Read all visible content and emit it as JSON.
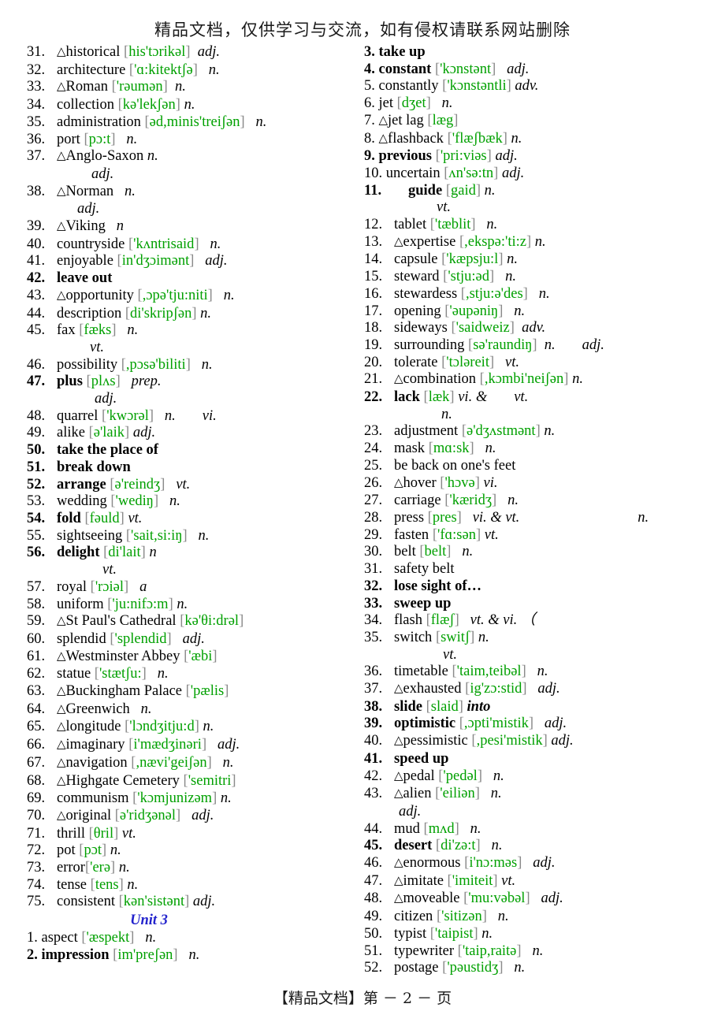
{
  "header": {
    "watermark_top": "精品文档，仅供学习与交流，如有侵权请联系网站删除"
  },
  "footer": {
    "watermark_bottom": "【精品文档】第 － 2 － 页"
  },
  "colors": {
    "phonetic_green": "#00a000",
    "bracket_gray": "#8a8a8a",
    "unit_blue": "#2222cc"
  },
  "unit_heading": "Unit 3",
  "left_column": [
    {
      "num": "31.",
      "tri": true,
      "word": "historical",
      "ph": "his'tɔrikəl",
      "pos": "adj.",
      "bold": false,
      "gap": "  "
    },
    {
      "num": "32.",
      "tri": false,
      "word": "architecture",
      "ph": "'ɑ:kitektʃə",
      "pos": "n.",
      "bold": false,
      "gap": "   "
    },
    {
      "num": "33.",
      "tri": true,
      "word": "Roman",
      "ph": "'rəumən",
      "pos": "n.",
      "bold": false,
      "gap": "  "
    },
    {
      "num": "34.",
      "tri": false,
      "word": "collection",
      "ph": "kə'lekʃən",
      "pos": "n.",
      "bold": false,
      "gap": " "
    },
    {
      "num": "35.",
      "tri": false,
      "word": "administration",
      "ph": "əd,minis'treiʃən",
      "pos": "n.",
      "bold": false,
      "gap": "   "
    },
    {
      "num": "36.",
      "tri": false,
      "word": "port",
      "ph": "pɔ:t",
      "pos": "n.",
      "bold": false,
      "gap": "   "
    },
    {
      "num": "37.",
      "tri": true,
      "word": "Anglo-Saxon",
      "ph": "",
      "pos": "n.",
      "bold": false,
      "gap": " "
    },
    {
      "cont": "adj.",
      "indent": 82
    },
    {
      "num": "38.",
      "tri": true,
      "word": "Norman",
      "ph": "",
      "pos": "n.",
      "bold": false,
      "gap": "   "
    },
    {
      "cont": "adj.",
      "indent": 64
    },
    {
      "num": "39.",
      "tri": true,
      "word": "Viking",
      "ph": "",
      "pos": "n",
      "bold": false,
      "gap": "   "
    },
    {
      "num": "40.",
      "tri": false,
      "word": "countryside",
      "ph": "'kʌntrisaid",
      "pos": "n.",
      "bold": false,
      "gap": "   "
    },
    {
      "num": "41.",
      "tri": false,
      "word": "enjoyable",
      "ph": "in'dʒɔimənt",
      "pos": "adj.",
      "bold": false,
      "gap": "   "
    },
    {
      "num": "42.",
      "tri": false,
      "word": "leave out",
      "ph": "",
      "pos": "",
      "bold": true,
      "gap": ""
    },
    {
      "num": "43.",
      "tri": true,
      "word": "opportunity",
      "ph": ",ɔpə'tju:niti",
      "pos": "n.",
      "bold": false,
      "gap": "   "
    },
    {
      "num": "44.",
      "tri": false,
      "word": "description",
      "ph": "di'skripʃən",
      "pos": "n.",
      "bold": false,
      "gap": " "
    },
    {
      "num": "45.",
      "tri": false,
      "word": "fax",
      "ph": "fæks",
      "pos": "n.",
      "bold": false,
      "gap": "   "
    },
    {
      "cont": "vt.",
      "indent": 80
    },
    {
      "num": "46.",
      "tri": false,
      "word": "possibility",
      "ph": ",pɔsə'biliti",
      "pos": "n.",
      "bold": false,
      "gap": "   "
    },
    {
      "num": "47.",
      "tri": false,
      "word": "plus",
      "ph": "plʌs",
      "pos": "prep.",
      "bold": true,
      "gap": "   "
    },
    {
      "cont": "adj.",
      "indent": 86
    },
    {
      "num": "48.",
      "tri": false,
      "word": "quarrel",
      "ph": "'kwɔrəl",
      "pos": "n.",
      "pos2": "vi.",
      "bold": false,
      "gap": "   "
    },
    {
      "num": "49.",
      "tri": false,
      "word": "alike",
      "ph": "ə'laik",
      "pos": "adj.",
      "bold": false,
      "gap": " "
    },
    {
      "num": "50.",
      "tri": false,
      "word": "take the place of",
      "ph": "",
      "pos": "",
      "bold": true,
      "gap": ""
    },
    {
      "num": "51.",
      "tri": false,
      "word": "break down",
      "ph": "",
      "pos": "",
      "bold": true,
      "gap": ""
    },
    {
      "num": "52.",
      "tri": false,
      "word": "arrange",
      "ph": "ə'reindʒ",
      "pos": "vt.",
      "bold": true,
      "gap": "   "
    },
    {
      "num": "53.",
      "tri": false,
      "word": "wedding",
      "ph": "'wediŋ",
      "pos": "n.",
      "bold": false,
      "gap": "   "
    },
    {
      "num": "54.",
      "tri": false,
      "word": "fold",
      "ph": "fəuld",
      "pos": "vt.",
      "bold": true,
      "gap": " "
    },
    {
      "num": "55.",
      "tri": false,
      "word": "sightseeing",
      "ph": "'sait,si:iŋ",
      "pos": "n.",
      "bold": false,
      "gap": "   "
    },
    {
      "num": "56.",
      "tri": false,
      "word": "delight",
      "ph": "di'lait",
      "pos": "n",
      "bold": true,
      "gap": " "
    },
    {
      "cont": "vt.",
      "indent": 96
    },
    {
      "num": "57.",
      "tri": false,
      "word": "royal",
      "ph": "'rɔiəl",
      "pos": "a",
      "bold": false,
      "gap": "   "
    },
    {
      "num": "58.",
      "tri": false,
      "word": "uniform",
      "ph": "'ju:nifɔ:m",
      "pos": "n.",
      "bold": false,
      "gap": " "
    },
    {
      "num": "59.",
      "tri": true,
      "word": "St Paul's Cathedral",
      "ph": "kə'θi:drəl",
      "pos": "",
      "bold": false,
      "gap": "  "
    },
    {
      "num": "60.",
      "tri": false,
      "word": "splendid",
      "ph": "'splendid",
      "pos": "adj.",
      "bold": false,
      "gap": "   "
    },
    {
      "num": "61.",
      "tri": true,
      "word": "Westminster Abbey",
      "ph": "'æbi",
      "pos": "",
      "bold": false,
      "gap": " "
    },
    {
      "num": "62.",
      "tri": false,
      "word": "statue",
      "ph": "'stætʃu:",
      "pos": "n.",
      "bold": false,
      "gap": "   "
    },
    {
      "num": "63.",
      "tri": true,
      "word": "Buckingham   Palace",
      "ph": "'pælis",
      "pos": "",
      "bold": false,
      "gap": " "
    },
    {
      "num": "64.",
      "tri": true,
      "word": "Greenwich",
      "ph": "",
      "pos": "n.",
      "bold": false,
      "gap": "   "
    },
    {
      "num": "65.",
      "tri": true,
      "word": "longitude",
      "ph": "'lɔndʒitju:d",
      "pos": "n.",
      "bold": false,
      "gap": ""
    },
    {
      "num": "66.",
      "tri": true,
      "word": "imaginary",
      "ph": "i'mædʒinəri",
      "pos": "adj.",
      "bold": false,
      "gap": "   "
    },
    {
      "num": "67.",
      "tri": true,
      "word": "navigation",
      "ph": ",nævi'geiʃən",
      "pos": "n.",
      "bold": false,
      "gap": "   "
    },
    {
      "num": "68.",
      "tri": true,
      "word": "Highgate Cemetery",
      "ph": "'semitri",
      "pos": "",
      "bold": false,
      "gap": " "
    },
    {
      "num": "69.",
      "tri": false,
      "word": "communism",
      "ph": "'kɔmjunizəm",
      "pos": "n.",
      "bold": false,
      "gap": " "
    },
    {
      "num": "70.",
      "tri": true,
      "word": "original",
      "ph": "ə'ridʒənəl",
      "pos": "adj.",
      "bold": false,
      "gap": "   "
    },
    {
      "num": "71.",
      "tri": false,
      "word": "thrill",
      "ph": "θril",
      "pos": "vt.",
      "bold": false,
      "gap": " "
    },
    {
      "num": "72.",
      "tri": false,
      "word": "pot",
      "ph": "pɔt",
      "pos": "n.",
      "bold": false,
      "gap": " "
    },
    {
      "num": "73.",
      "tri": false,
      "word": "error",
      "ph": "'erə",
      "pos": "n.",
      "bold": false,
      "gap": "",
      "nospace": true
    },
    {
      "num": "74.",
      "tri": false,
      "word": "tense",
      "ph": "tens",
      "pos": "n.",
      "bold": false,
      "gap": " "
    },
    {
      "num": "75.",
      "tri": false,
      "word": "consistent",
      "ph": "kən'sistənt",
      "pos": "adj.",
      "bold": false,
      "gap": " "
    },
    {
      "unit": true
    },
    {
      "num": "1.",
      "tri": false,
      "word": "aspect",
      "ph": "'æspekt",
      "pos": "n.",
      "bold": false,
      "gap": "   ",
      "tight": true
    },
    {
      "num": "2.",
      "tri": false,
      "word": "impression",
      "ph": "im'preʃən",
      "pos": "n.",
      "bold": true,
      "gap": "   ",
      "tight": true
    }
  ],
  "right_column": [
    {
      "num": "3.",
      "tri": false,
      "word": "take up",
      "ph": "",
      "pos": "",
      "bold": true,
      "gap": "",
      "tight": true
    },
    {
      "num": "4.",
      "tri": false,
      "word": "constant",
      "ph": "'kɔnstənt",
      "pos": "adj.",
      "bold": true,
      "gap": "   ",
      "tight": true
    },
    {
      "num": "5.",
      "tri": false,
      "word": "constantly",
      "ph": "'kɔnstəntli",
      "pos": "adv.",
      "bold": false,
      "gap": " ",
      "tight": true
    },
    {
      "num": "6.",
      "tri": false,
      "word": "jet",
      "ph": "dʒet",
      "pos": "n.",
      "bold": false,
      "gap": "   ",
      "tight": true
    },
    {
      "num": "7.",
      "tri": true,
      "word": "jet lag",
      "ph": "læg",
      "pos": "",
      "bold": false,
      "gap": " ",
      "tight": true
    },
    {
      "num": "8.",
      "tri": true,
      "word": "flashback",
      "ph": "'flæʃbæk",
      "pos": "n.",
      "bold": false,
      "gap": " ",
      "tight": true
    },
    {
      "num": "9.",
      "tri": false,
      "word": "previous",
      "ph": "'pri:viəs",
      "pos": "adj.",
      "bold": true,
      "gap": " ",
      "tight": true
    },
    {
      "num": "10.",
      "tri": false,
      "word": "uncertain",
      "ph": "ʌn'sə:tn",
      "pos": "adj.",
      "bold": false,
      "gap": " ",
      "tight": true
    },
    {
      "num": "11.",
      "tri": false,
      "word": "guide",
      "ph": "gaid",
      "pos": "n.",
      "bold": true,
      "gap": " ",
      "extraindent": true
    },
    {
      "cont": "vt.",
      "indent": 92
    },
    {
      "num": "12.",
      "tri": false,
      "word": "tablet",
      "ph": "'tæblit",
      "pos": "n.",
      "bold": false,
      "gap": "   "
    },
    {
      "num": "13.",
      "tri": true,
      "word": "expertise",
      "ph": ",ekspə:'ti:z",
      "pos": "n.",
      "bold": false,
      "gap": " "
    },
    {
      "num": "14.",
      "tri": false,
      "word": "capsule",
      "ph": "'kæpsju:l",
      "pos": "n.",
      "bold": false,
      "gap": " "
    },
    {
      "num": "15.",
      "tri": false,
      "word": "steward",
      "ph": "'stju:əd",
      "pos": "n.",
      "bold": false,
      "gap": "   "
    },
    {
      "num": "16.",
      "tri": false,
      "word": "stewardess",
      "ph": ",stju:ə'des",
      "pos": "n.",
      "bold": false,
      "gap": "   "
    },
    {
      "num": "17.",
      "tri": false,
      "word": "opening",
      "ph": "'əupəniŋ",
      "pos": "n.",
      "bold": false,
      "gap": "   "
    },
    {
      "num": "18.",
      "tri": false,
      "word": "sideways",
      "ph": "'saidweiz",
      "pos": "adv.",
      "bold": false,
      "gap": "  "
    },
    {
      "num": "19.",
      "tri": false,
      "word": "surrounding",
      "ph": "sə'raundiŋ",
      "pos": "n.",
      "pos2": "adj.",
      "bold": false,
      "gap": "  "
    },
    {
      "num": "20.",
      "tri": false,
      "word": "tolerate",
      "ph": "'tɔləreit",
      "pos": "vt.",
      "bold": false,
      "gap": "   "
    },
    {
      "num": "21.",
      "tri": true,
      "word": "combination",
      "ph": ",kɔmbi'neiʃən",
      "pos": "n.",
      "bold": false,
      "gap": " "
    },
    {
      "num": "22.",
      "tri": false,
      "word": "lack",
      "ph": "læk",
      "pos": "vi. &",
      "pos2": "vt.",
      "bold": true,
      "gap": " "
    },
    {
      "cont": "n.",
      "indent": 98
    },
    {
      "num": "23.",
      "tri": false,
      "word": "adjustment",
      "ph": "ə'dʒʌstmənt",
      "pos": "n.",
      "bold": false,
      "gap": " "
    },
    {
      "num": "24.",
      "tri": false,
      "word": "mask",
      "ph": "mɑ:sk",
      "pos": "n.",
      "bold": false,
      "gap": "   "
    },
    {
      "num": "25.",
      "tri": false,
      "word": "be back on one's feet",
      "ph": "",
      "pos": "",
      "bold": false,
      "gap": ""
    },
    {
      "num": "26.",
      "tri": true,
      "word": "hover",
      "ph": "'hɔvə",
      "pos": "vi.",
      "bold": false,
      "gap": " "
    },
    {
      "num": "27.",
      "tri": false,
      "word": "carriage",
      "ph": "'kæridʒ",
      "pos": "n.",
      "bold": false,
      "gap": "   "
    },
    {
      "num": "28.",
      "tri": false,
      "word": "press",
      "ph": "pres",
      "pos": "vi. & vt.",
      "pos3": "n.",
      "bold": false,
      "gap": "   "
    },
    {
      "num": "29.",
      "tri": false,
      "word": "fasten",
      "ph": "'fɑ:sən",
      "pos": "vt.",
      "bold": false,
      "gap": " "
    },
    {
      "num": "30.",
      "tri": false,
      "word": "belt",
      "ph": "belt",
      "pos": "n.",
      "bold": false,
      "gap": "   "
    },
    {
      "num": "31.",
      "tri": false,
      "word": "safety belt",
      "ph": "",
      "pos": "",
      "bold": false,
      "gap": ""
    },
    {
      "num": "32.",
      "tri": false,
      "word": "lose sight of…",
      "ph": "",
      "pos": "",
      "bold": true,
      "gap": ""
    },
    {
      "num": "33.",
      "tri": false,
      "word": "sweep up",
      "ph": "",
      "pos": "",
      "bold": true,
      "gap": ""
    },
    {
      "num": "34.",
      "tri": false,
      "word": "flash",
      "ph": "flæʃ",
      "pos": "vt. & vi. （",
      "bold": false,
      "gap": "   "
    },
    {
      "num": "35.",
      "tri": false,
      "word": "switch",
      "ph": "switʃ",
      "pos": "n.",
      "bold": false,
      "gap": " "
    },
    {
      "cont": "vt.",
      "indent": 100
    },
    {
      "num": "36.",
      "tri": false,
      "word": "timetable",
      "ph": "'taim,teibəl",
      "pos": "n.",
      "bold": false,
      "gap": "   "
    },
    {
      "num": "37.",
      "tri": true,
      "word": "exhausted",
      "ph": "ig'zɔ:stid",
      "pos": "adj.",
      "bold": false,
      "gap": "   "
    },
    {
      "num": "38.",
      "tri": false,
      "word": "slide",
      "ph": "slaid",
      "pos": "into",
      "bold": true,
      "gap": " ",
      "posbold": true
    },
    {
      "num": "39.",
      "tri": false,
      "word": "optimistic",
      "ph": ",ɔpti'mistik",
      "pos": "adj.",
      "bold": true,
      "gap": "   "
    },
    {
      "num": "40.",
      "tri": true,
      "word": "pessimistic",
      "ph": ",pesi'mistik",
      "pos": "adj.",
      "bold": false,
      "gap": " "
    },
    {
      "num": "41.",
      "tri": false,
      "word": "speed up",
      "ph": "",
      "pos": "",
      "bold": true,
      "gap": ""
    },
    {
      "num": "42.",
      "tri": true,
      "word": "pedal",
      "ph": "'pedəl",
      "pos": "n.",
      "bold": false,
      "gap": "   "
    },
    {
      "num": "43.",
      "tri": true,
      "word": "alien",
      "ph": "'eiliən",
      "pos": "n.",
      "bold": false,
      "gap": "   "
    },
    {
      "cont": "adj.",
      "indent": 44
    },
    {
      "num": "44.",
      "tri": false,
      "word": "mud",
      "ph": "mʌd",
      "pos": "n.",
      "bold": false,
      "gap": "   "
    },
    {
      "num": "45.",
      "tri": false,
      "word": "desert",
      "ph": "di'zə:t",
      "pos": "n.",
      "bold": true,
      "gap": "   "
    },
    {
      "num": "46.",
      "tri": true,
      "word": "enormous",
      "ph": "i'nɔ:məs",
      "pos": "adj.",
      "bold": false,
      "gap": "   "
    },
    {
      "num": "47.",
      "tri": true,
      "word": "imitate",
      "ph": "'imiteit",
      "pos": "vt.",
      "bold": false,
      "gap": " "
    },
    {
      "num": "48.",
      "tri": true,
      "word": "moveable",
      "ph": "'mu:vəbəl",
      "pos": "adj.",
      "bold": false,
      "gap": "   "
    },
    {
      "num": "49.",
      "tri": false,
      "word": "citizen",
      "ph": "'sitizən",
      "pos": "n.",
      "bold": false,
      "gap": "   "
    },
    {
      "num": "50.",
      "tri": false,
      "word": "typist",
      "ph": "'taipist",
      "pos": "n.",
      "bold": false,
      "gap": " "
    },
    {
      "num": "51.",
      "tri": false,
      "word": "typewriter",
      "ph": "'taip,raitə",
      "pos": "n.",
      "bold": false,
      "gap": "   "
    },
    {
      "num": "52.",
      "tri": false,
      "word": "postage",
      "ph": "'pəustidʒ",
      "pos": "n.",
      "bold": false,
      "gap": "   "
    }
  ]
}
